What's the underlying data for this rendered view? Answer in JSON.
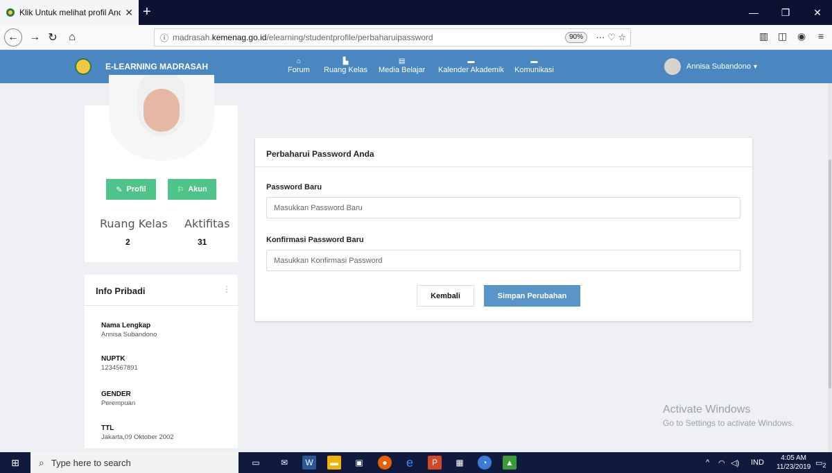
{
  "browser": {
    "tab_title": "Klik Untuk melihat profil Anda",
    "url_prefix": "madrasah.",
    "url_domain": "kemenag.go.id",
    "url_path": "/elearning/studentprofile/perbaharuipassword",
    "zoom": "90%"
  },
  "header": {
    "brand": "E-LEARNING MADRASAH",
    "menu": [
      {
        "label": "Forum",
        "icon": "home-icon"
      },
      {
        "label": "Ruang Kelas",
        "icon": "classroom-icon"
      },
      {
        "label": "Media Belajar",
        "icon": "book-icon"
      },
      {
        "label": "Kalender Akademik",
        "icon": "calendar-icon"
      },
      {
        "label": "Komunikasi",
        "icon": "chat-icon"
      }
    ],
    "user_name": "Annisa Subandono"
  },
  "profile": {
    "btn_profil": "Profil",
    "btn_akun": "Akun",
    "stats": [
      {
        "label": "Ruang Kelas",
        "value": "2"
      },
      {
        "label": "Aktifitas",
        "value": "31"
      }
    ]
  },
  "info": {
    "title": "Info Pribadi",
    "fields": [
      {
        "key": "Nama Lengkap",
        "value": "Annisa Subandono"
      },
      {
        "key": "NUPTK",
        "value": "1234567891"
      },
      {
        "key": "GENDER",
        "value": "Perempuan"
      },
      {
        "key": "TTL",
        "value": "Jakarta,09 Oktober 2002"
      }
    ]
  },
  "form": {
    "title": "Perbaharui Password Anda",
    "new_password_label": "Password Baru",
    "new_password_placeholder": "Masukkan Password Baru",
    "confirm_label": "Konfirmasi Password Baru",
    "confirm_placeholder": "Masukkan Konfirmasi Password",
    "back_label": "Kembali",
    "save_label": "Simpan Perubahan"
  },
  "watermark": {
    "line1": "Activate Windows",
    "line2": "Go to Settings to activate Windows."
  },
  "taskbar": {
    "search_placeholder": "Type here to search",
    "language": "IND",
    "time": "4:05 AM",
    "date": "11/23/2019",
    "notification_count": "2"
  },
  "colors": {
    "header": "#4a86bf",
    "green_button": "#4fc48a",
    "save_button": "#5a95c8",
    "taskbar": "#0f1a3c"
  }
}
